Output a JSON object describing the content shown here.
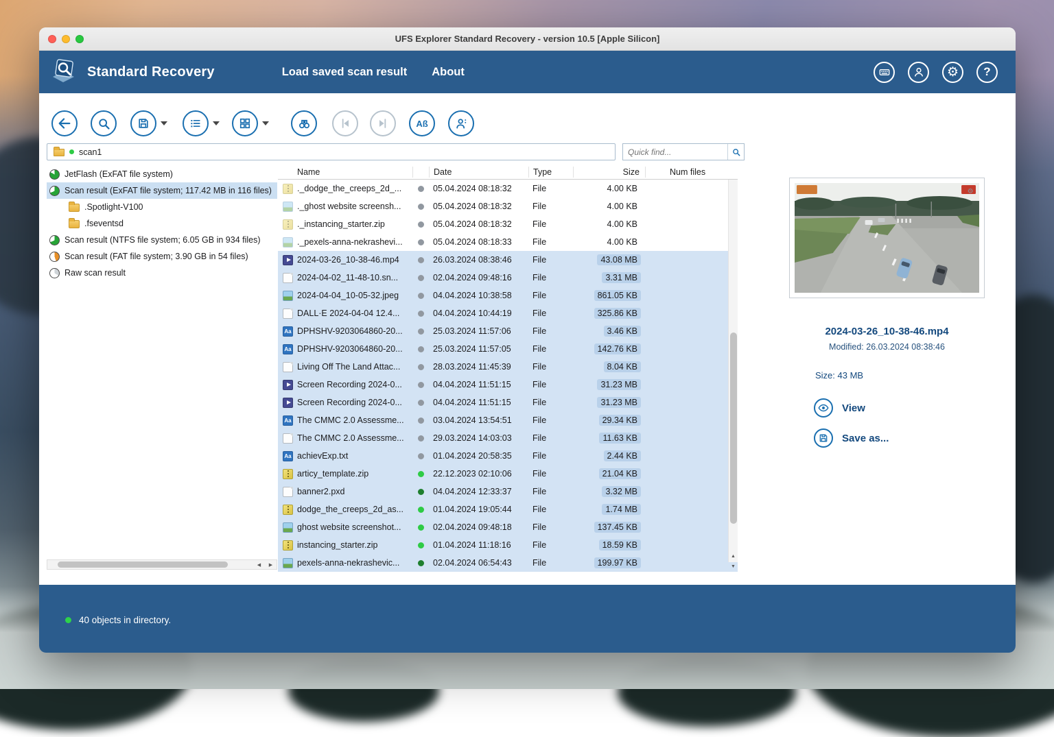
{
  "window": {
    "title": "UFS Explorer Standard Recovery - version 10.5 [Apple Silicon]"
  },
  "header": {
    "app_name": "Standard Recovery",
    "menu": [
      {
        "label": "Load saved scan result"
      },
      {
        "label": "About"
      }
    ],
    "icon_names": [
      "keyboard-icon",
      "account-icon",
      "settings-gear-icon",
      "help-icon"
    ]
  },
  "toolbar": {
    "encoding_label": "Aß",
    "icon_names": [
      "back-arrow-icon",
      "magnifier-icon",
      "save-icon",
      "list-view-icon",
      "grid-view-icon",
      "binoculars-icon",
      "previous-item-icon",
      "next-item-icon",
      "encoding-text-icon",
      "user-tools-icon"
    ]
  },
  "breadcrumb": {
    "location": "scan1"
  },
  "quick_find": {
    "placeholder": "Quick find..."
  },
  "tree": {
    "items": [
      {
        "label": "JetFlash (ExFAT file system)",
        "icon": "disk",
        "indent": 0,
        "selected": false
      },
      {
        "label": "Scan result (ExFAT file system; 117.42 MB in 116 files)",
        "icon": "scan-green",
        "indent": 0,
        "selected": true
      },
      {
        "label": ".Spotlight-V100",
        "icon": "folder",
        "indent": 1,
        "selected": false
      },
      {
        "label": ".fseventsd",
        "icon": "folder",
        "indent": 1,
        "selected": false
      },
      {
        "label": "Scan result (NTFS file system; 6.05 GB in 934 files)",
        "icon": "scan-green",
        "indent": 0,
        "selected": false
      },
      {
        "label": "Scan result (FAT file system; 3.90 GB in 54 files)",
        "icon": "scan-orange",
        "indent": 0,
        "selected": false
      },
      {
        "label": "Raw scan result",
        "icon": "scan-gray",
        "indent": 0,
        "selected": false
      }
    ]
  },
  "file_table": {
    "columns": [
      "Name",
      "Date",
      "Type",
      "Size",
      "Num files"
    ],
    "rows": [
      {
        "name": "._dodge_the_creeps_2d_...",
        "date": "05.04.2024 08:18:32",
        "type": "File",
        "size": "4.00 KB",
        "icon": "zip",
        "faded": true,
        "dot": "gray",
        "selected": false
      },
      {
        "name": "._ghost website screensh...",
        "date": "05.04.2024 08:18:32",
        "type": "File",
        "size": "4.00 KB",
        "icon": "img",
        "faded": true,
        "dot": "gray",
        "selected": false
      },
      {
        "name": "._instancing_starter.zip",
        "date": "05.04.2024 08:18:32",
        "type": "File",
        "size": "4.00 KB",
        "icon": "zip",
        "faded": true,
        "dot": "gray",
        "selected": false
      },
      {
        "name": "._pexels-anna-nekrashevi...",
        "date": "05.04.2024 08:18:33",
        "type": "File",
        "size": "4.00 KB",
        "icon": "img",
        "faded": true,
        "dot": "gray",
        "selected": false
      },
      {
        "name": "2024-03-26_10-38-46.mp4",
        "date": "26.03.2024 08:38:46",
        "type": "File",
        "size": "43.08 MB",
        "icon": "video",
        "dot": "gray",
        "selected": true
      },
      {
        "name": "2024-04-02_11-48-10.sn...",
        "date": "02.04.2024 09:48:16",
        "type": "File",
        "size": "3.31 MB",
        "icon": "file",
        "dot": "gray",
        "selected": true
      },
      {
        "name": "2024-04-04_10-05-32.jpeg",
        "date": "04.04.2024 10:38:58",
        "type": "File",
        "size": "861.05 KB",
        "icon": "img",
        "dot": "gray",
        "selected": true
      },
      {
        "name": "DALL·E 2024-04-04 12.4...",
        "date": "04.04.2024 10:44:19",
        "type": "File",
        "size": "325.86 KB",
        "icon": "file",
        "dot": "gray",
        "selected": true
      },
      {
        "name": "DPHSHV-9203064860-20...",
        "date": "25.03.2024 11:57:06",
        "type": "File",
        "size": "3.46 KB",
        "icon": "text",
        "dot": "gray",
        "selected": true
      },
      {
        "name": "DPHSHV-9203064860-20...",
        "date": "25.03.2024 11:57:05",
        "type": "File",
        "size": "142.76 KB",
        "icon": "text",
        "dot": "gray",
        "selected": true
      },
      {
        "name": "Living Off The Land Attac...",
        "date": "28.03.2024 11:45:39",
        "type": "File",
        "size": "8.04 KB",
        "icon": "file",
        "dot": "gray",
        "selected": true
      },
      {
        "name": "Screen Recording 2024-0...",
        "date": "04.04.2024 11:51:15",
        "type": "File",
        "size": "31.23 MB",
        "icon": "video",
        "dot": "gray",
        "selected": true
      },
      {
        "name": "Screen Recording 2024-0...",
        "date": "04.04.2024 11:51:15",
        "type": "File",
        "size": "31.23 MB",
        "icon": "video",
        "dot": "gray",
        "selected": true
      },
      {
        "name": "The CMMC 2.0 Assessme...",
        "date": "03.04.2024 13:54:51",
        "type": "File",
        "size": "29.34 KB",
        "icon": "text",
        "dot": "gray",
        "selected": true
      },
      {
        "name": "The CMMC 2.0 Assessme...",
        "date": "29.03.2024 14:03:03",
        "type": "File",
        "size": "11.63 KB",
        "icon": "file",
        "dot": "gray",
        "selected": true
      },
      {
        "name": "achievExp.txt",
        "date": "01.04.2024 20:58:35",
        "type": "File",
        "size": "2.44 KB",
        "icon": "text",
        "dot": "gray",
        "selected": true
      },
      {
        "name": "articy_template.zip",
        "date": "22.12.2023 02:10:06",
        "type": "File",
        "size": "21.04 KB",
        "icon": "zip",
        "dot": "green",
        "selected": true
      },
      {
        "name": "banner2.pxd",
        "date": "04.04.2024 12:33:37",
        "type": "File",
        "size": "3.32 MB",
        "icon": "file",
        "dot": "dgreen",
        "selected": true
      },
      {
        "name": "dodge_the_creeps_2d_as...",
        "date": "01.04.2024 19:05:44",
        "type": "File",
        "size": "1.74 MB",
        "icon": "zip",
        "dot": "green",
        "selected": true
      },
      {
        "name": "ghost website screenshot...",
        "date": "02.04.2024 09:48:18",
        "type": "File",
        "size": "137.45 KB",
        "icon": "img",
        "dot": "green",
        "selected": true
      },
      {
        "name": "instancing_starter.zip",
        "date": "01.04.2024 11:18:16",
        "type": "File",
        "size": "18.59 KB",
        "icon": "zip",
        "dot": "green",
        "selected": true
      },
      {
        "name": "pexels-anna-nekrashevic...",
        "date": "02.04.2024 06:54:43",
        "type": "File",
        "size": "199.97 KB",
        "icon": "img",
        "dot": "dgreen",
        "selected": true
      }
    ]
  },
  "preview": {
    "filename": "2024-03-26_10-38-46.mp4",
    "modified": "Modified: 26.03.2024 08:38:46",
    "size": "Size: 43 MB",
    "view_label": "View",
    "save_as_label": "Save as..."
  },
  "statusbar": {
    "text": "40 objects in directory."
  }
}
